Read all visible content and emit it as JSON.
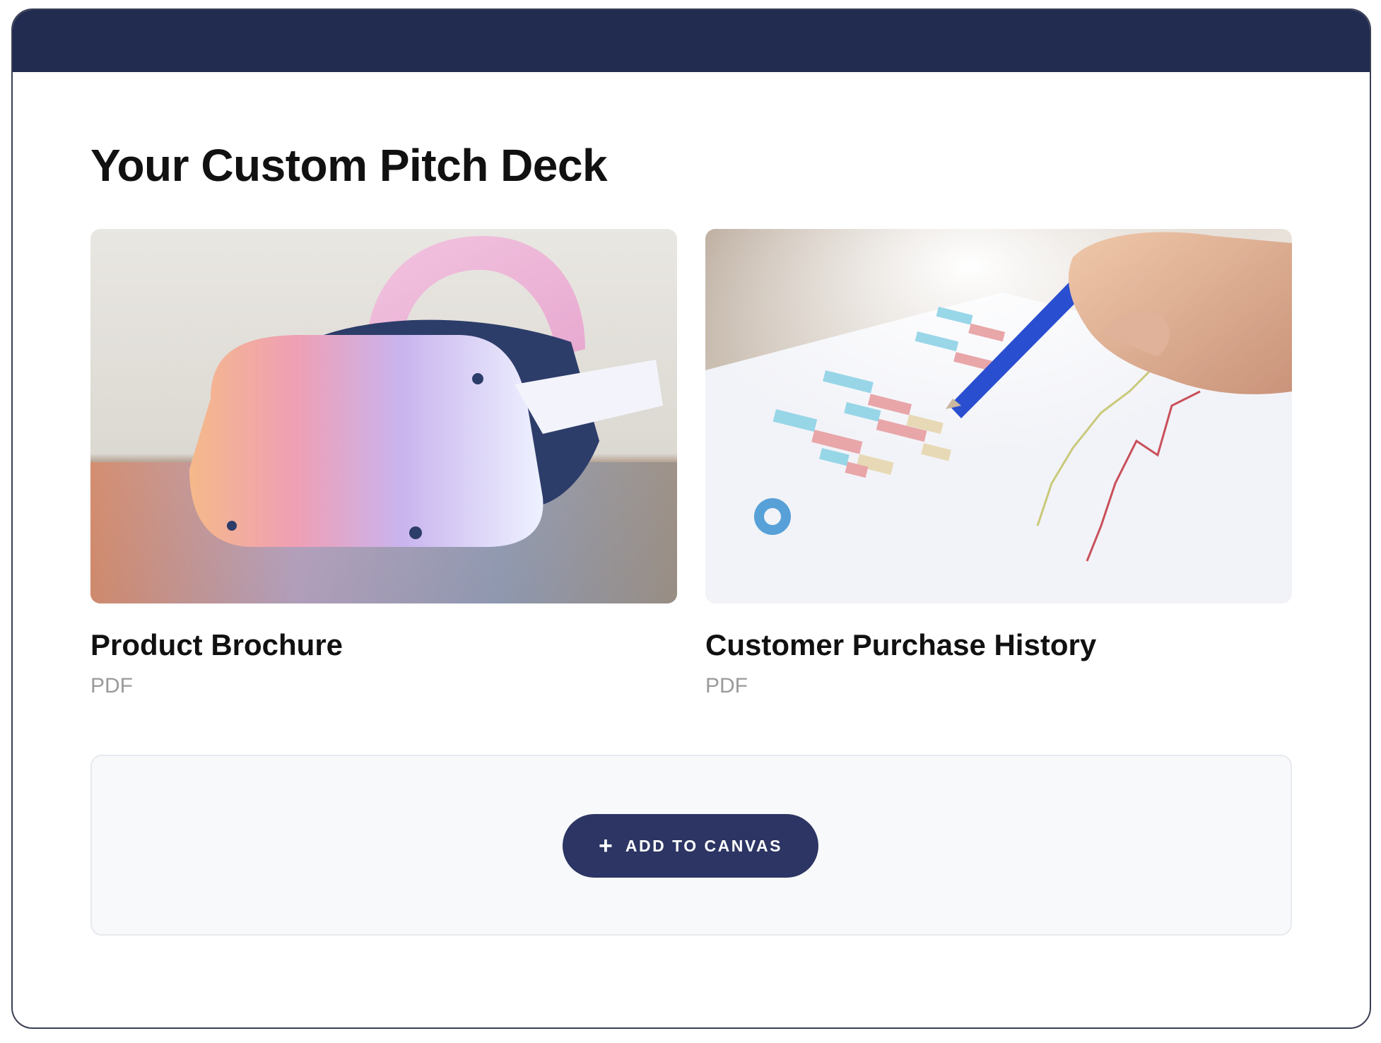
{
  "page": {
    "title": "Your Custom Pitch Deck"
  },
  "cards": [
    {
      "name": "Product Brochure",
      "type": "PDF",
      "thumbnail": "vr-headset-photo"
    },
    {
      "name": "Customer Purchase History",
      "type": "PDF",
      "thumbnail": "bar-chart-document-photo"
    }
  ],
  "canvas": {
    "add_button_label": "ADD TO CANVAS",
    "add_icon": "plus-icon"
  },
  "colors": {
    "header_bar": "#212c50",
    "button": "#2c3563",
    "muted_text": "#9a9a9a"
  }
}
